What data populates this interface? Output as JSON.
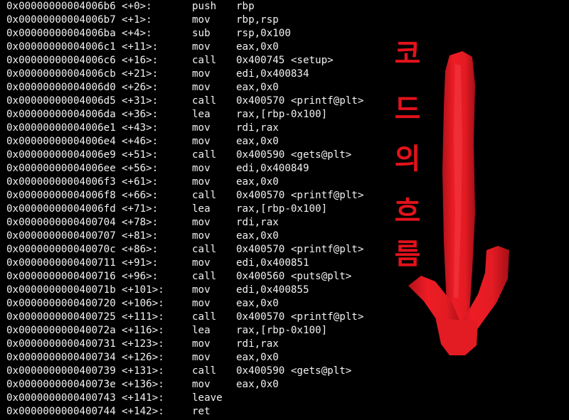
{
  "disassembly": [
    {
      "addr": "0x00000000004006b6",
      "offset": "<+0>:",
      "mnemonic": "push",
      "operands": "rbp"
    },
    {
      "addr": "0x00000000004006b7",
      "offset": "<+1>:",
      "mnemonic": "mov",
      "operands": "rbp,rsp"
    },
    {
      "addr": "0x00000000004006ba",
      "offset": "<+4>:",
      "mnemonic": "sub",
      "operands": "rsp,0x100"
    },
    {
      "addr": "0x00000000004006c1",
      "offset": "<+11>:",
      "mnemonic": "mov",
      "operands": "eax,0x0"
    },
    {
      "addr": "0x00000000004006c6",
      "offset": "<+16>:",
      "mnemonic": "call",
      "operands": "0x400745 <setup>"
    },
    {
      "addr": "0x00000000004006cb",
      "offset": "<+21>:",
      "mnemonic": "mov",
      "operands": "edi,0x400834"
    },
    {
      "addr": "0x00000000004006d0",
      "offset": "<+26>:",
      "mnemonic": "mov",
      "operands": "eax,0x0"
    },
    {
      "addr": "0x00000000004006d5",
      "offset": "<+31>:",
      "mnemonic": "call",
      "operands": "0x400570 <printf@plt>"
    },
    {
      "addr": "0x00000000004006da",
      "offset": "<+36>:",
      "mnemonic": "lea",
      "operands": "rax,[rbp-0x100]"
    },
    {
      "addr": "0x00000000004006e1",
      "offset": "<+43>:",
      "mnemonic": "mov",
      "operands": "rdi,rax"
    },
    {
      "addr": "0x00000000004006e4",
      "offset": "<+46>:",
      "mnemonic": "mov",
      "operands": "eax,0x0"
    },
    {
      "addr": "0x00000000004006e9",
      "offset": "<+51>:",
      "mnemonic": "call",
      "operands": "0x400590 <gets@plt>"
    },
    {
      "addr": "0x00000000004006ee",
      "offset": "<+56>:",
      "mnemonic": "mov",
      "operands": "edi,0x400849"
    },
    {
      "addr": "0x00000000004006f3",
      "offset": "<+61>:",
      "mnemonic": "mov",
      "operands": "eax,0x0"
    },
    {
      "addr": "0x00000000004006f8",
      "offset": "<+66>:",
      "mnemonic": "call",
      "operands": "0x400570 <printf@plt>"
    },
    {
      "addr": "0x00000000004006fd",
      "offset": "<+71>:",
      "mnemonic": "lea",
      "operands": "rax,[rbp-0x100]"
    },
    {
      "addr": "0x0000000000400704",
      "offset": "<+78>:",
      "mnemonic": "mov",
      "operands": "rdi,rax"
    },
    {
      "addr": "0x0000000000400707",
      "offset": "<+81>:",
      "mnemonic": "mov",
      "operands": "eax,0x0"
    },
    {
      "addr": "0x000000000040070c",
      "offset": "<+86>:",
      "mnemonic": "call",
      "operands": "0x400570 <printf@plt>"
    },
    {
      "addr": "0x0000000000400711",
      "offset": "<+91>:",
      "mnemonic": "mov",
      "operands": "edi,0x400851"
    },
    {
      "addr": "0x0000000000400716",
      "offset": "<+96>:",
      "mnemonic": "call",
      "operands": "0x400560 <puts@plt>"
    },
    {
      "addr": "0x000000000040071b",
      "offset": "<+101>:",
      "mnemonic": "mov",
      "operands": "edi,0x400855"
    },
    {
      "addr": "0x0000000000400720",
      "offset": "<+106>:",
      "mnemonic": "mov",
      "operands": "eax,0x0"
    },
    {
      "addr": "0x0000000000400725",
      "offset": "<+111>:",
      "mnemonic": "call",
      "operands": "0x400570 <printf@plt>"
    },
    {
      "addr": "0x000000000040072a",
      "offset": "<+116>:",
      "mnemonic": "lea",
      "operands": "rax,[rbp-0x100]"
    },
    {
      "addr": "0x0000000000400731",
      "offset": "<+123>:",
      "mnemonic": "mov",
      "operands": "rdi,rax"
    },
    {
      "addr": "0x0000000000400734",
      "offset": "<+126>:",
      "mnemonic": "mov",
      "operands": "eax,0x0"
    },
    {
      "addr": "0x0000000000400739",
      "offset": "<+131>:",
      "mnemonic": "call",
      "operands": "0x400590 <gets@plt>"
    },
    {
      "addr": "0x000000000040073e",
      "offset": "<+136>:",
      "mnemonic": "mov",
      "operands": "eax,0x0"
    },
    {
      "addr": "0x0000000000400743",
      "offset": "<+141>:",
      "mnemonic": "leave",
      "operands": ""
    },
    {
      "addr": "0x0000000000400744",
      "offset": "<+142>:",
      "mnemonic": "ret",
      "operands": ""
    }
  ],
  "annotation": {
    "chars": [
      "코",
      "드",
      "의",
      "흐",
      "름"
    ],
    "color": "#e3121b"
  },
  "arrow": {
    "color": "#e31b23",
    "icon": "down-arrow-icon"
  },
  "colors": {
    "background": "#000000",
    "text": "#f2f2f2"
  }
}
